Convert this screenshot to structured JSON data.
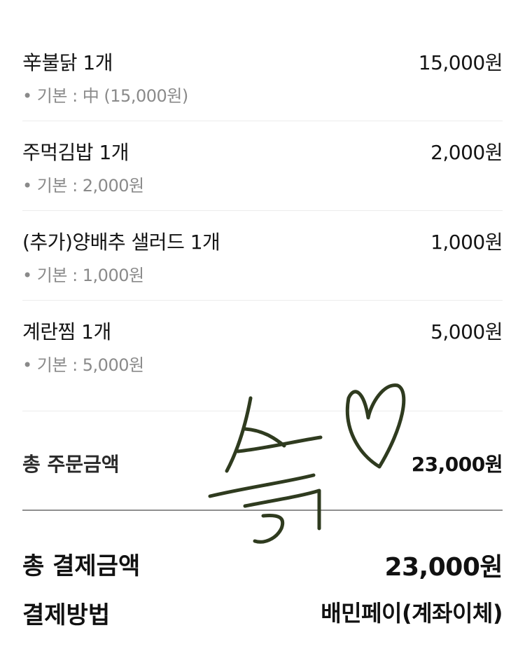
{
  "items": [
    {
      "name": "辛불닭 1개",
      "price": "15,000원",
      "option": "• 기본 : 中 (15,000원)"
    },
    {
      "name": "주먹김밥 1개",
      "price": "2,000원",
      "option": "• 기본 : 2,000원"
    },
    {
      "name": "(추가)양배추 샐러드 1개",
      "price": "1,000원",
      "option": "• 기본 : 1,000원"
    },
    {
      "name": "계란찜 1개",
      "price": "5,000원",
      "option": "• 기본 : 5,000원"
    }
  ],
  "summary": {
    "subtotal_label": "총 주문금액",
    "subtotal_value": "23,000원",
    "total_label": "총 결제금액",
    "total_value": "23,000원",
    "method_label": "결제방법",
    "method_value": "배민페이(계좌이체)"
  },
  "colors": {
    "ink": "#111111",
    "muted": "#8a8a8a",
    "divider": "#ececec",
    "doodle": "#2f3b1f"
  },
  "icons": {
    "doodle": "handwritten-heart-doodle"
  }
}
